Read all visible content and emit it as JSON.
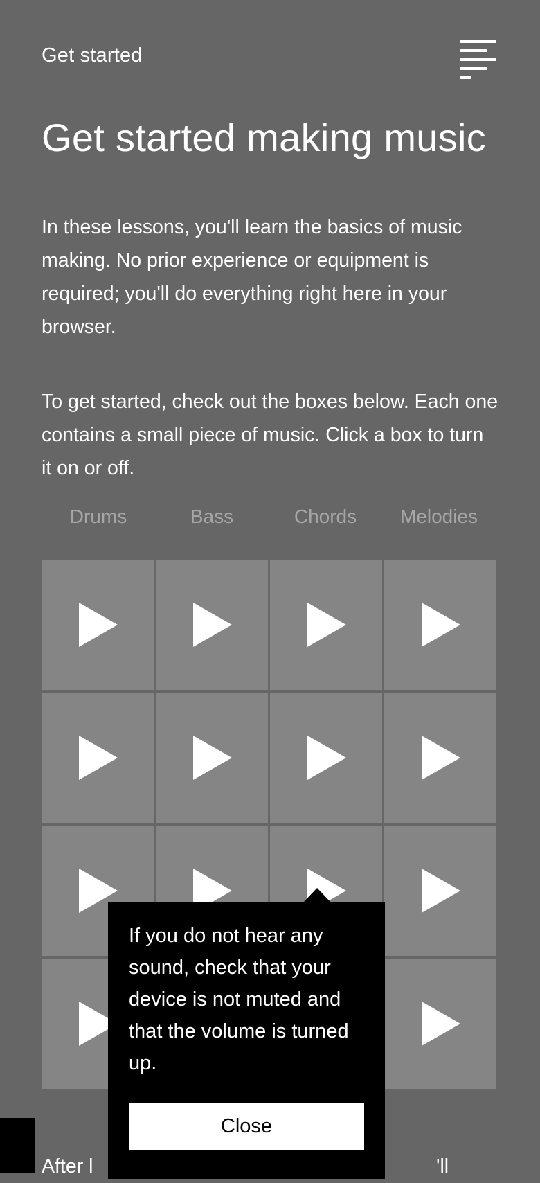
{
  "header": {
    "title": "Get started",
    "menu_icon": "hamburger-menu-icon"
  },
  "main": {
    "heading": "Get started making music",
    "intro": "In these lessons, you'll learn the basics of music making. No prior experience or equipment is required; you'll do everything right here in your browser.",
    "instructions": "To get started, check out the boxes below. Each one contains a small piece of music. Click a box to turn it on or off.",
    "columns": [
      "Drums",
      "Bass",
      "Chords",
      "Melodies"
    ],
    "grid_rows": 4,
    "cell_icon": "play-icon",
    "following_text_start": "After l",
    "following_text_end": "'ll"
  },
  "tooltip": {
    "message": "If you do not hear any sound, check that your device is not muted and that the volume is turned up.",
    "close_label": "Close"
  },
  "colors": {
    "background": "#666666",
    "cell": "#858585",
    "column_label": "#a6a6a6",
    "tooltip_bg": "#000000",
    "text": "#ffffff"
  }
}
